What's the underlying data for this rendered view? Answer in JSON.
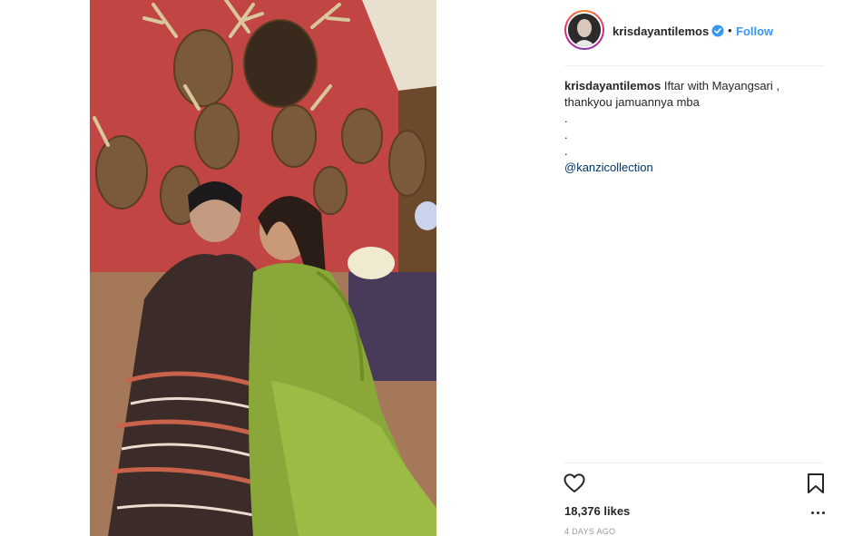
{
  "post": {
    "username": "krisdayantilemos",
    "verified": true,
    "separator": "•",
    "follow_label": "Follow",
    "caption": {
      "username": "krisdayantilemos",
      "text_line1": "Iftar with Mayangsari ,",
      "text_line2": "thankyou jamuannya mba",
      "dots": [
        ".",
        ".",
        "."
      ],
      "mention": "@kanzicollection"
    },
    "likes": "18,376 likes",
    "timestamp": "4 DAYS AGO"
  },
  "colors": {
    "link_blue": "#3897f0",
    "mention_blue": "#003569",
    "text": "#262626",
    "muted": "#999999"
  },
  "icons": [
    "verified-badge-icon",
    "heart-icon",
    "bookmark-icon",
    "more-options-icon"
  ]
}
